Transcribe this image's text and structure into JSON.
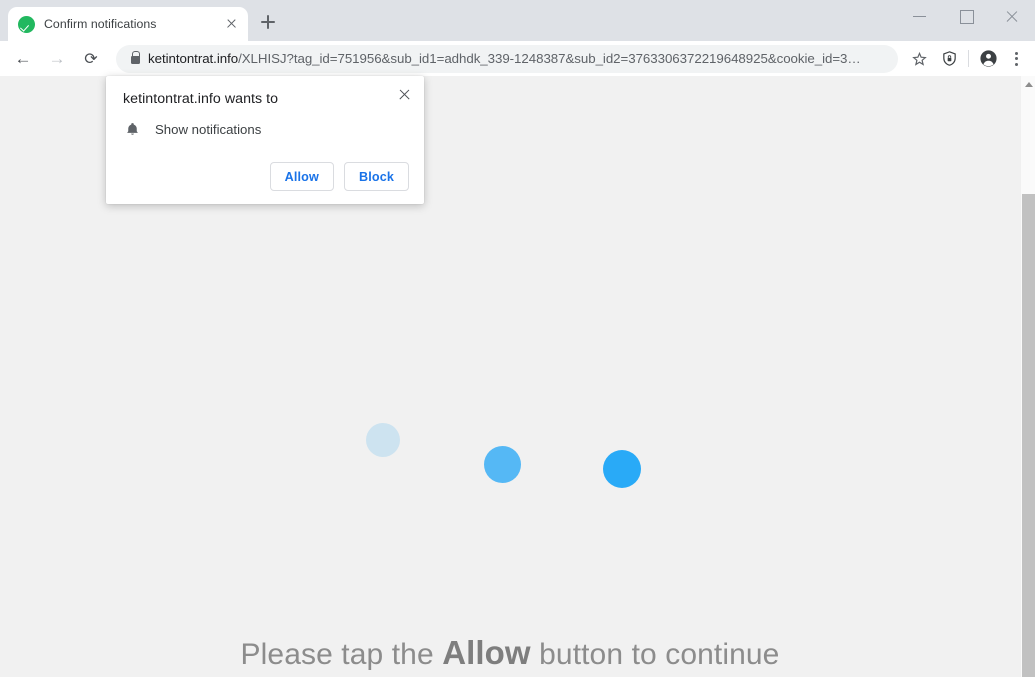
{
  "window": {
    "controls": {
      "minimize": "minimize-window",
      "maximize": "maximize-window",
      "close": "close-window"
    }
  },
  "tabstrip": {
    "tabs": [
      {
        "title": "Confirm notifications",
        "favicon": "green-check-circle-icon",
        "close_label": "close-tab-icon",
        "active": true
      }
    ],
    "new_tab_label": "plus-icon"
  },
  "toolbar": {
    "back_glyph": "←",
    "forward_glyph": "→",
    "reload_glyph": "⟳",
    "back_name": "back-button",
    "forward_name": "forward-button",
    "reload_name": "reload-button",
    "security_icon": "lock-icon",
    "url_host": "ketintontrat.info",
    "url_path": "/XLHISJ?tag_id=751956&sub_id1=adhdk_339-1248387&sub_id2=3763306372219648925&cookie_id=3…",
    "url_full": "ketintontrat.info/XLHISJ?tag_id=751956&sub_id1=adhdk_339-1248387&sub_id2=3763306372219648925&cookie_id=3…",
    "bookmark_icon": "star-icon",
    "shield_icon": "shield-lock-icon",
    "profile_icon": "account-avatar-icon",
    "menu_icon": "three-dot-menu-icon"
  },
  "permission_dialog": {
    "title": "ketintontrat.info wants to",
    "request_icon": "bell-icon",
    "request_label": "Show notifications",
    "allow_label": "Allow",
    "block_label": "Block",
    "close_label": "close-dialog-icon",
    "accent_color": "#1a73e8"
  },
  "page": {
    "background_color": "#f1f1f1",
    "message_prefix": "Please tap the ",
    "message_emphasis": "Allow",
    "message_suffix": " button to continue",
    "text_color": "#8c8c8c",
    "loader": {
      "name": "loading-dots",
      "dots": [
        {
          "color": "#cde3f0",
          "size": 34
        },
        {
          "color": "#55b8f5",
          "size": 37
        },
        {
          "color": "#29aaf7",
          "size": 38
        }
      ]
    }
  },
  "scrollbar": {
    "up_arrow": "scroll-up-arrow-icon",
    "thumb": "vertical-scrollbar-thumb"
  }
}
